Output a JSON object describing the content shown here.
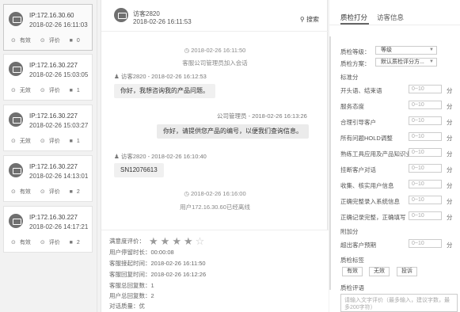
{
  "sessions": [
    {
      "ip": "IP:172.16.30.60",
      "time": "2018-02-26 16:11:03",
      "valid": "有效",
      "rate": "评价",
      "count": "0",
      "active": true
    },
    {
      "ip": "IP:172.16.30.227",
      "time": "2018-02-26 15:03:05",
      "valid": "无效",
      "rate": "评价",
      "count": "1",
      "active": false
    },
    {
      "ip": "IP:172.16.30.227",
      "time": "2018-02-26 15:03:27",
      "valid": "无效",
      "rate": "评价",
      "count": "1",
      "active": false
    },
    {
      "ip": "IP:172.16.30.227",
      "time": "2018-02-26 14:13:01",
      "valid": "有效",
      "rate": "评价",
      "count": "2",
      "active": false
    },
    {
      "ip": "IP:172.16.30.227",
      "time": "2018-02-26 14:17:21",
      "valid": "有效",
      "rate": "评价",
      "count": "2",
      "active": false
    }
  ],
  "chat": {
    "header": {
      "name": "访客2820",
      "time": "2018-02-26 16:11:53",
      "search_label": "搜索"
    },
    "sys1_time": "2018-02-26 16:11:50",
    "sys1_text": "客服公司管理员加入会话",
    "m1_meta": "访客2820 - 2018-02-26 16:12:53",
    "m1_text": "你好，我想咨询我的产品问题。",
    "m2_meta": "公司管理员 - 2018-02-26 16:13:26",
    "m2_text": "你好，请提供您产品的编号，以便我们查询信息。",
    "m3_meta": "访客2820 - 2018-02-26 16:10:40",
    "m3_text": "SN12076613",
    "sys2_time": "2018-02-26 16:16:00",
    "sys2_text": "用户172.16.30.60已经离线"
  },
  "footer": {
    "rating_label": "满意度评价：",
    "stars_filled": 4,
    "stars_total": 5,
    "row1": "用户停留时长：00:00:08",
    "row2": "客服接起时间：2018-02-26 16:11:50",
    "row3": "客服回复时间：2018-02-26 16:12:26",
    "row4": "客服总回复数：1",
    "row5": "用户总回复数：2",
    "row6": "对话质量：优"
  },
  "panel": {
    "tab1": "质检打分",
    "tab2": "访客信息",
    "level_label": "质检等级：",
    "level_value": "等级",
    "item_label": "质检方案：",
    "item_value": "默认质检评分方...",
    "sec_standard": "标准分",
    "score_items": [
      "开头语、结束语",
      "服务态度",
      "合理引导客户",
      "所有问题HOLD调整",
      "熟练工具应用及产品知识业务",
      "挂断客户对话",
      "收集、核实用户信息",
      "正确完整录入系统信息",
      "正确记录完整，正确填写"
    ],
    "score_placeholder": "0~10",
    "unit": "分",
    "sec_bonus": "附加分",
    "bonus_items": [
      "超出客户预期"
    ],
    "tag_label": "质检标签",
    "tags": [
      "有效",
      "无效",
      "投诉"
    ],
    "comment_label": "质检评语",
    "comment_placeholder": "请输入文字评价（最多输入，建议字数，最多200字符）"
  }
}
